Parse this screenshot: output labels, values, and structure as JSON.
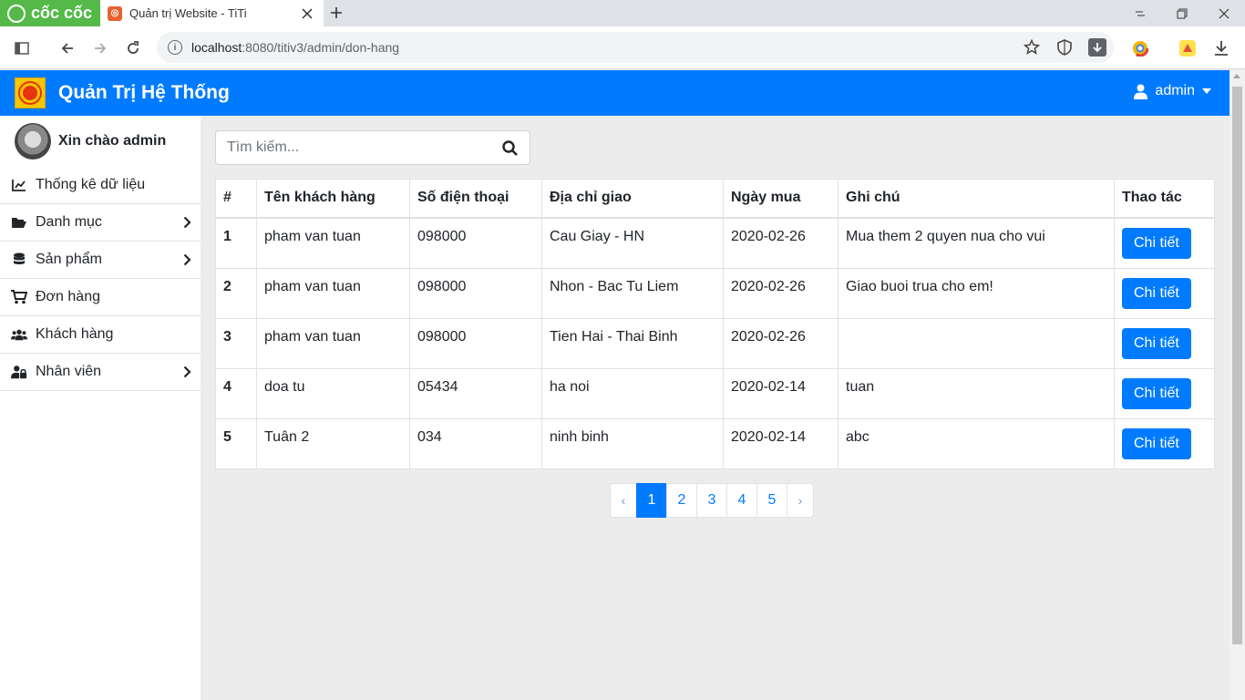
{
  "browser": {
    "logo_text": "cốc cốc",
    "tab_title": "Quản trị Website - TiTi",
    "url_host": "localhost",
    "url_path": ":8080/titiv3/admin/don-hang"
  },
  "navbar": {
    "brand": "Quản Trị Hệ Thống",
    "user": "admin"
  },
  "sidebar": {
    "greeting": "Xin chào admin",
    "items": [
      {
        "label": "Thống kê dữ liệu",
        "icon": "chart-line-icon",
        "has_arrow": false
      },
      {
        "label": "Danh mục",
        "icon": "folder-open-icon",
        "has_arrow": true
      },
      {
        "label": "Sản phẩm",
        "icon": "database-icon",
        "has_arrow": true
      },
      {
        "label": "Đơn hàng",
        "icon": "shopping-cart-icon",
        "has_arrow": false
      },
      {
        "label": "Khách hàng",
        "icon": "users-icon",
        "has_arrow": false
      },
      {
        "label": "Nhân viên",
        "icon": "user-lock-icon",
        "has_arrow": true
      }
    ]
  },
  "search": {
    "placeholder": "Tìm kiếm..."
  },
  "table": {
    "headers": [
      "#",
      "Tên khách hàng",
      "Số điện thoại",
      "Địa chỉ giao",
      "Ngày mua",
      "Ghi chú",
      "Thao tác"
    ],
    "rows": [
      {
        "idx": "1",
        "name": "pham van tuan",
        "phone": "098000",
        "address": "Cau Giay - HN",
        "date": "2020-02-26",
        "note": "Mua them 2 quyen nua cho vui",
        "action": "Chi tiết"
      },
      {
        "idx": "2",
        "name": "pham van tuan",
        "phone": "098000",
        "address": "Nhon - Bac Tu Liem",
        "date": "2020-02-26",
        "note": "Giao buoi trua cho em!",
        "action": "Chi tiết"
      },
      {
        "idx": "3",
        "name": "pham van tuan",
        "phone": "098000",
        "address": "Tien Hai - Thai Binh",
        "date": "2020-02-26",
        "note": "",
        "action": "Chi tiết"
      },
      {
        "idx": "4",
        "name": "doa tu",
        "phone": "05434",
        "address": "ha noi",
        "date": "2020-02-14",
        "note": "tuan",
        "action": "Chi tiết"
      },
      {
        "idx": "5",
        "name": "Tuân 2",
        "phone": "034",
        "address": "ninh binh",
        "date": "2020-02-14",
        "note": "abc",
        "action": "Chi tiết"
      }
    ]
  },
  "pagination": {
    "prev": "‹",
    "next": "›",
    "pages": [
      "1",
      "2",
      "3",
      "4",
      "5"
    ],
    "current": "1"
  },
  "colors": {
    "primary": "#007bff",
    "background": "#ececec"
  }
}
